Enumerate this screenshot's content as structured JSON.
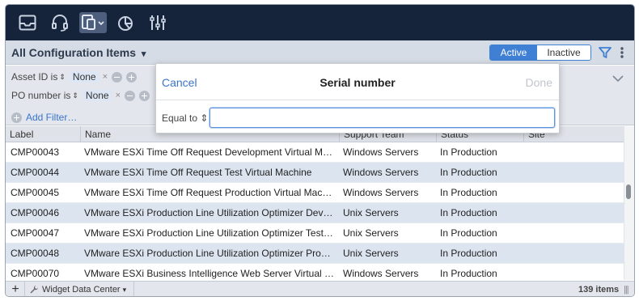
{
  "toolbar": {
    "icons": [
      "inbox-icon",
      "headset-icon",
      "devices-icon",
      "pie-chart-icon",
      "sliders-icon"
    ]
  },
  "header": {
    "title": "All Configuration Items",
    "title_caret": "▾",
    "segment_active": "Active",
    "segment_inactive": "Inactive"
  },
  "filters": {
    "rows": [
      {
        "label": "Asset ID is",
        "value": "None"
      },
      {
        "label": "PO number is",
        "value": "None"
      }
    ],
    "sort_glyph": "⇕",
    "remove_glyph": "×",
    "add_filter": "Add Filter…"
  },
  "table": {
    "columns": [
      "Label",
      "Name",
      "Support Team",
      "Status",
      "Site"
    ],
    "rows": [
      {
        "label": "CMP00043",
        "name": "VMware ESXi Time Off Request Development Virtual M…",
        "team": "Windows Servers",
        "status": "In Production"
      },
      {
        "label": "CMP00044",
        "name": "VMware ESXi Time Off Request Test Virtual Machine",
        "team": "Windows Servers",
        "status": "In Production"
      },
      {
        "label": "CMP00045",
        "name": "VMware ESXi Time Off Request Production Virtual Mac…",
        "team": "Windows Servers",
        "status": "In Production"
      },
      {
        "label": "CMP00046",
        "name": "VMware ESXi Production Line Utilization Optimizer Dev…",
        "team": "Unix Servers",
        "status": "In Production"
      },
      {
        "label": "CMP00047",
        "name": "VMware ESXi Production Line Utilization Optimizer Test …",
        "team": "Unix Servers",
        "status": "In Production"
      },
      {
        "label": "CMP00048",
        "name": "VMware ESXi Production Line Utilization Optimizer Prod…",
        "team": "Unix Servers",
        "status": "In Production"
      },
      {
        "label": "CMP00070",
        "name": "VMware ESXi Business Intelligence Web Server Virtual …",
        "team": "Windows Servers",
        "status": "In Production"
      }
    ]
  },
  "footer": {
    "add": "+",
    "view_name": "Widget Data Center",
    "view_caret": "▾",
    "count": "139 items",
    "grip": "|||"
  },
  "popover": {
    "cancel": "Cancel",
    "title": "Serial number",
    "done": "Done",
    "operator": "Equal to ⇕",
    "input_value": "",
    "input_placeholder": ""
  },
  "colors": {
    "toolbar_bg": "#15233b",
    "accent": "#3f7fd4",
    "row_alt": "#dce4ef"
  }
}
